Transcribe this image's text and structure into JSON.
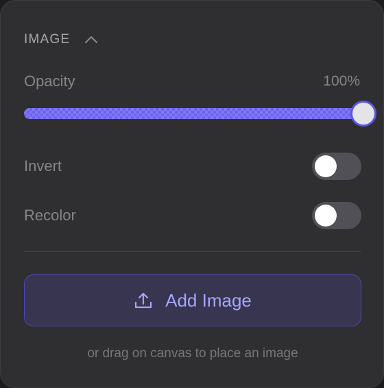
{
  "section": {
    "title": "IMAGE",
    "collapse_icon": "chevron-up-icon"
  },
  "opacity": {
    "label": "Opacity",
    "value_text": "100%",
    "value": 1.0
  },
  "invert": {
    "label": "Invert",
    "enabled": false
  },
  "recolor": {
    "label": "Recolor",
    "enabled": false
  },
  "add_image": {
    "label": "Add Image",
    "icon": "upload-icon"
  },
  "hint": "or drag on canvas to place an image",
  "colors": {
    "accent": "#6c63f0",
    "accent_text": "#a7a4ff",
    "panel_bg": "#2f2f32",
    "toggle_off": "#505056"
  }
}
